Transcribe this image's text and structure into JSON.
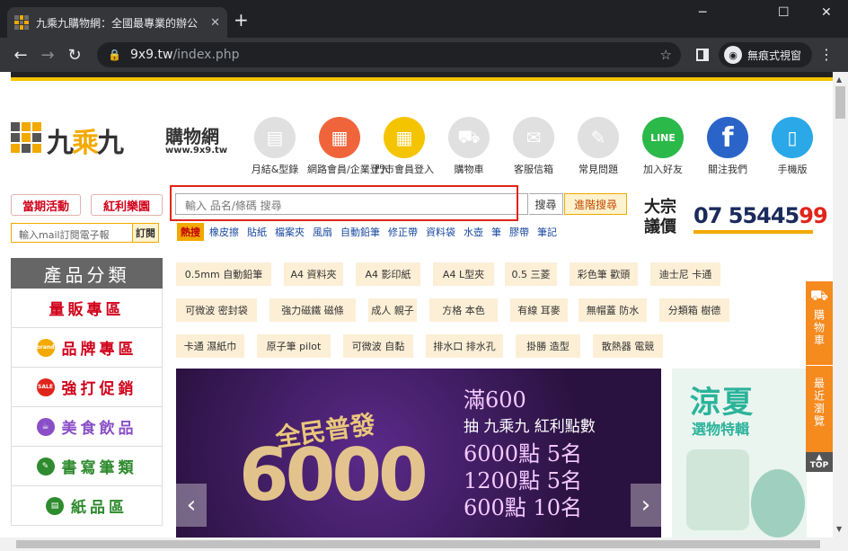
{
  "browser": {
    "tab_title": "九乘九購物網：全國最專業的辦公",
    "tab_close": "✕",
    "new_tab": "+",
    "url_host": "9x9.tw",
    "url_path": "/index.php",
    "incognito_label": "無痕式視窗",
    "win_min": "─",
    "win_max": "☐",
    "win_close": "✕",
    "back": "←",
    "forward": "→",
    "reload": "↻",
    "lock": "🔒",
    "star": "☆",
    "menu": "⋮"
  },
  "logo": {
    "main_a": "九",
    "main_b": "乘",
    "main_c": "九",
    "sub": "購物網",
    "url": "www.9x9.tw"
  },
  "top_icons": [
    {
      "label": "月結&型錄",
      "color": "#e0e0e0",
      "glyph": "▤"
    },
    {
      "label": "網路會員/企業登入",
      "color": "#f0643c",
      "glyph": "▦"
    },
    {
      "label": "門市會員登入",
      "color": "#f5c400",
      "glyph": "▦"
    },
    {
      "label": "購物車",
      "color": "#e0e0e0",
      "glyph": "⛟"
    },
    {
      "label": "客服信箱",
      "color": "#e0e0e0",
      "glyph": "✉"
    },
    {
      "label": "常見問題",
      "color": "#e0e0e0",
      "glyph": "✎"
    },
    {
      "label": "加入好友",
      "color": "#2bb94a",
      "glyph": "LINE"
    },
    {
      "label": "關注我們",
      "color": "#2b64c8",
      "glyph": "f"
    },
    {
      "label": "手機版",
      "color": "#2aa8e8",
      "glyph": "▯"
    }
  ],
  "promo": {
    "current": "當期活動",
    "bonus": "紅利樂園"
  },
  "mail": {
    "placeholder": "輸入mail訂閱電子報",
    "button": "訂閱"
  },
  "search": {
    "placeholder": "輸入 品名/條碼 搜尋",
    "button": "搜尋",
    "advanced": "進階搜尋"
  },
  "hot": {
    "tag": "熱搜",
    "links": [
      "橡皮擦",
      "貼紙",
      "檔案夾",
      "風扇",
      "自動鉛筆",
      "修正帶",
      "資料袋",
      "水壺",
      "筆",
      "膠帶",
      "筆記"
    ]
  },
  "bulk": {
    "label": "大宗議價",
    "phone_a": "07 55445",
    "phone_b": "99"
  },
  "categories": {
    "title": "產品分類",
    "items": [
      {
        "label": "量販專區",
        "icon": "",
        "cls": ""
      },
      {
        "label": "品牌專區",
        "icon": "brand",
        "cls": ""
      },
      {
        "label": "強打促銷",
        "icon": "SALE",
        "cls": ""
      },
      {
        "label": "美食飲品",
        "icon": "☕",
        "cls": "p"
      },
      {
        "label": "書寫筆類",
        "icon": "✎",
        "cls": "g"
      },
      {
        "label": "紙品區",
        "icon": "▤",
        "cls": "g"
      }
    ]
  },
  "tags": [
    "0.5mm 自動鉛筆",
    "A4 資料夾",
    "A4 影印紙",
    "A4 L型夾",
    "0.5 三菱",
    "彩色筆 歡頭",
    "迪士尼 卡通",
    "可微波 密封袋",
    "強力磁鐵 磁條",
    "成人 親子",
    "方格 本色",
    "有線 耳麥",
    "無帽蓋 防水",
    "分類箱 樹德",
    "卡通 濕紙巾",
    "原子筆 pilot",
    "可微波 自黏",
    "排水口 排水孔",
    "掛勝 造型",
    "散熱器 電競"
  ],
  "banner": {
    "title": "全民普發",
    "big": "6000",
    "lines": [
      "滿600",
      "抽 九乘九 紅利點數",
      "6000點 5名",
      "1200點 5名",
      "600點 10名"
    ],
    "prev": "‹",
    "next": "›"
  },
  "side_banner": {
    "title": "涼夏",
    "sub": "選物特輯"
  },
  "float": {
    "cart": "購物車",
    "recent": "最近瀏覽",
    "top": "TOP"
  }
}
